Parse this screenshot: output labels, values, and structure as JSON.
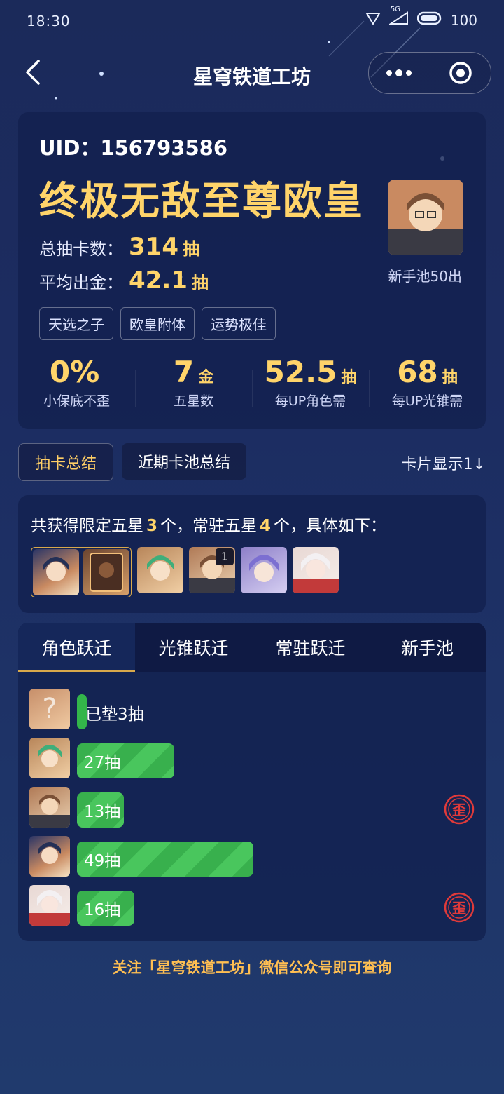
{
  "status_bar": {
    "time": "18:30",
    "network": "5G",
    "battery": "100"
  },
  "nav": {
    "title": "星穹铁道工坊"
  },
  "profile": {
    "uid_label": "UID：156793586",
    "rank_title": "终极无敌至尊欧皇",
    "total_pulls_label": "总抽卡数：",
    "total_pulls_value": "314",
    "total_pulls_unit": "抽",
    "avg_gold_label": "平均出金：",
    "avg_gold_value": "42.1",
    "avg_gold_unit": "抽",
    "tags": [
      "天选之子",
      "欧皇附体",
      "运势极佳"
    ],
    "avatar_caption": "新手池50出"
  },
  "metrics": [
    {
      "value": "0%",
      "unit": "",
      "label": "小保底不歪"
    },
    {
      "value": "7",
      "unit": "金",
      "label": "五星数"
    },
    {
      "value": "52.5",
      "unit": "抽",
      "label": "每UP角色需"
    },
    {
      "value": "68",
      "unit": "抽",
      "label": "每UP光锥需"
    }
  ],
  "summary_tabs": {
    "active": "抽卡总结",
    "other": "近期卡池总结",
    "display_toggle": "卡片显示1↓"
  },
  "obtained": {
    "prefix": "共获得限定五星",
    "limited_count": "3",
    "middle": "个，常驻五星",
    "standard_count": "4",
    "suffix": "个，具体如下：",
    "thumb_badge": "1"
  },
  "pool_tabs": [
    "角色跃迁",
    "光锥跃迁",
    "常驻跃迁",
    "新手池"
  ],
  "pull_rows": [
    {
      "label": "已垫3抽",
      "pulls": 3,
      "lost": false
    },
    {
      "label": "27抽",
      "pulls": 27,
      "lost": false
    },
    {
      "label": "13抽",
      "pulls": 13,
      "lost": true
    },
    {
      "label": "49抽",
      "pulls": 49,
      "lost": false
    },
    {
      "label": "16抽",
      "pulls": 16,
      "lost": true
    }
  ],
  "lost_badge": "歪",
  "footer": "关注「星穹铁道工坊」微信公众号即可查询"
}
